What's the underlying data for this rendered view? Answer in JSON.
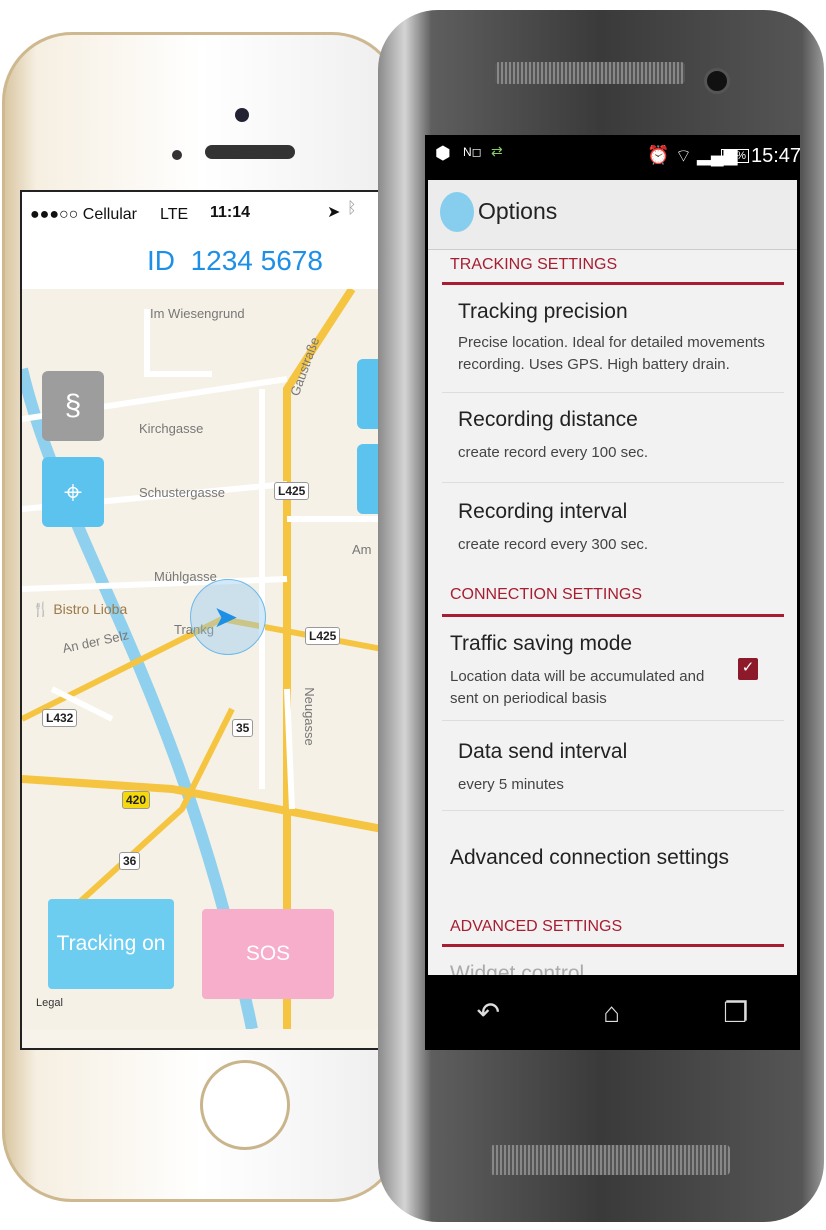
{
  "iphone": {
    "status": {
      "carrier": "●●●○○ Cellular",
      "network": "LTE",
      "time": "11:14",
      "icons": [
        "location-arrow-icon",
        "bluetooth-icon"
      ]
    },
    "header": {
      "id_label": "ID",
      "id_value": "1234 5678"
    },
    "map": {
      "streets": [
        "Im Wiesengrund",
        "Gaustraße",
        "Kirchgasse",
        "Schustergasse",
        "Mühlgasse",
        "An der Selz",
        "Trankg",
        "Neugasse",
        "Am"
      ],
      "poi": "Bistro Lioba",
      "road_shields": [
        "L425",
        "L425",
        "L432",
        "35",
        "420",
        "36"
      ],
      "legal": "Legal"
    },
    "buttons": {
      "tracking": "Tracking on",
      "sos": "SOS"
    },
    "colors": {
      "accent": "#1e8fe6",
      "tracking": "#6ccdf0",
      "sos": "#f7aecb"
    }
  },
  "android": {
    "status": {
      "time": "15:47",
      "battery": "85%",
      "icons": [
        "app-icon",
        "nfc-icon",
        "data-transfer-icon",
        "alarm-icon",
        "wifi-icon",
        "signal-icon",
        "battery-icon"
      ]
    },
    "actionbar": {
      "title": "Options"
    },
    "sections": [
      {
        "header": "TRACKING SETTINGS",
        "items": [
          {
            "title": "Tracking precision",
            "summary": "Precise location. Ideal for detailed movements recording. Uses GPS. High battery drain."
          },
          {
            "title": "Recording distance",
            "summary": "create record every 100 sec."
          },
          {
            "title": "Recording interval",
            "summary": "create record every 300 sec."
          }
        ]
      },
      {
        "header": "CONNECTION SETTINGS",
        "items": [
          {
            "title": "Traffic saving mode",
            "summary": "Location data will be accumulated and sent on periodical basis",
            "checked": true
          },
          {
            "title": "Data send interval",
            "summary": "every 5 minutes"
          },
          {
            "title": "Advanced connection settings"
          }
        ]
      },
      {
        "header": "ADVANCED SETTINGS",
        "items": [
          {
            "title": "Widget control"
          }
        ]
      }
    ],
    "colors": {
      "accent": "#a71d31"
    }
  }
}
